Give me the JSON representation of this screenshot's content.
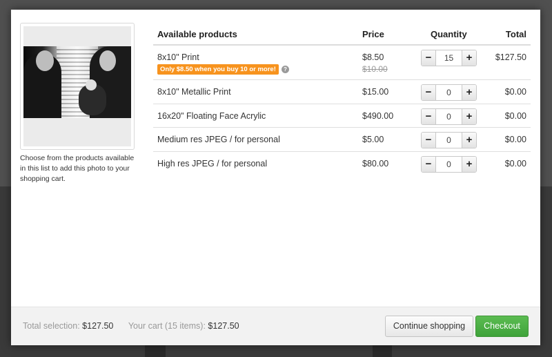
{
  "side_text": "Choose from the products available in this list to add this photo to your shopping cart.",
  "table": {
    "headers": {
      "product": "Available products",
      "price": "Price",
      "quantity": "Quantity",
      "total": "Total"
    },
    "rows": [
      {
        "name": "8x10\" Print",
        "price": "$8.50",
        "old_price": "$10.00",
        "promo": "Only $8.50 when you buy 10 or more!",
        "quantity": "15",
        "total": "$127.50"
      },
      {
        "name": "8x10\" Metallic Print",
        "price": "$15.00",
        "quantity": "0",
        "total": "$0.00"
      },
      {
        "name": "16x20\" Floating Face Acrylic",
        "price": "$490.00",
        "quantity": "0",
        "total": "$0.00"
      },
      {
        "name": "Medium res JPEG / for personal",
        "price": "$5.00",
        "quantity": "0",
        "total": "$0.00"
      },
      {
        "name": "High res JPEG / for personal",
        "price": "$80.00",
        "quantity": "0",
        "total": "$0.00"
      }
    ],
    "stepper": {
      "minus": "−",
      "plus": "+"
    },
    "help_glyph": "?"
  },
  "footer": {
    "total_label": "Total selection:",
    "total_value": "$127.50",
    "cart_label": "Your cart (15 items):",
    "cart_value": "$127.50",
    "continue_label": "Continue shopping",
    "checkout_label": "Checkout"
  },
  "colors": {
    "promo": "#f7931e",
    "checkout": "#4cae44"
  }
}
